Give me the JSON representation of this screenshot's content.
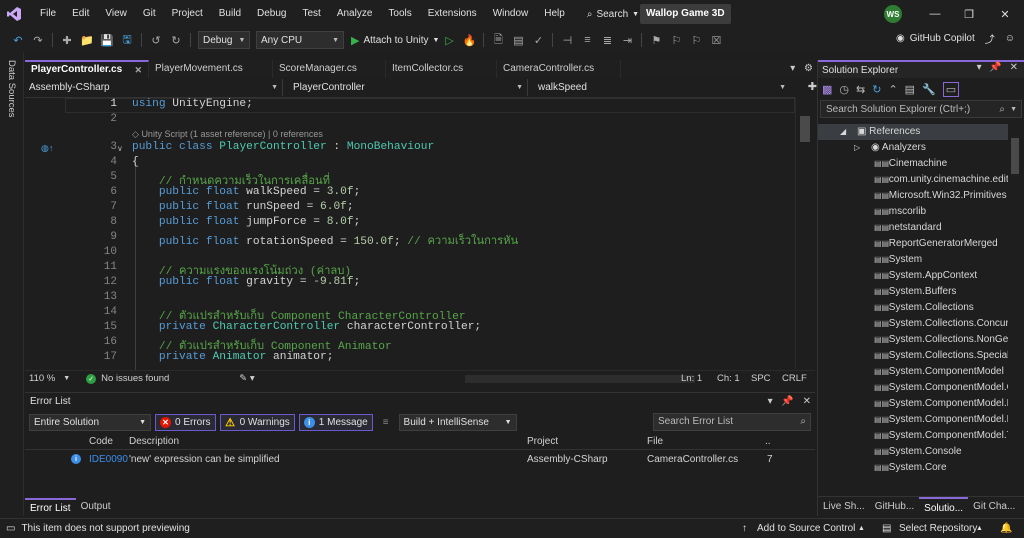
{
  "titlebar": {
    "menu": [
      "File",
      "Edit",
      "View",
      "Git",
      "Project",
      "Build",
      "Debug",
      "Test",
      "Analyze",
      "Tools",
      "Extensions",
      "Window",
      "Help"
    ],
    "search_label": "Search",
    "solution_name": "Wallop Game 3D",
    "avatar_initials": "WS"
  },
  "toolbar": {
    "configuration": "Debug",
    "platform": "Any CPU",
    "attach_label": "Attach to Unity",
    "copilot_label": "GitHub Copilot"
  },
  "left_strip": {
    "label": "Data Sources"
  },
  "tabs": [
    {
      "label": "PlayerController.cs",
      "active": true
    },
    {
      "label": "PlayerMovement.cs",
      "active": false
    },
    {
      "label": "ScoreManager.cs",
      "active": false
    },
    {
      "label": "ItemCollector.cs",
      "active": false
    },
    {
      "label": "CameraController.cs",
      "active": false
    }
  ],
  "navbar": {
    "project": "Assembly-CSharp",
    "type": "PlayerController",
    "member": "walkSpeed"
  },
  "code": {
    "line_numbers": [
      "1",
      "2",
      "3",
      "4",
      "5",
      "6",
      "7",
      "8",
      "9",
      "10",
      "11",
      "12",
      "13",
      "14",
      "15",
      "16",
      "17"
    ],
    "codelens": "Unity Script (1 asset reference) | 0 references",
    "lines": {
      "l1_kw": "using",
      "l1_rest": " UnityEngine;",
      "l3_kw": "public class",
      "l3_name": "PlayerController",
      "l3_colon": " : ",
      "l3_base": "MonoBehaviour",
      "l4": "{",
      "l5_cm": "// กำหนดความเร็วในการเคลื่อนที่",
      "l6_kw": "public float",
      "l6_rest": " walkSpeed = ",
      "l6_num": "3.0f",
      "l7_kw": "public float",
      "l7_rest": " runSpeed = ",
      "l7_num": "6.0f",
      "l8_kw": "public float",
      "l8_rest": " jumpForce = ",
      "l8_num": "8.0f",
      "l9_kw": "public float",
      "l9_rest": " rotationSpeed = ",
      "l9_num": "150.0f",
      "l9_cm": " // ความเร็วในการหัน",
      "l11_cm": "// ความแรงของแรงโน้มถ่วง (ค่าลบ)",
      "l12_kw": "public float",
      "l12_rest": " gravity = ",
      "l12_num": "-9.81f",
      "l14_cm": "// ตัวแปรสำหรับเก็บ Component CharacterController",
      "l15_kw": "private",
      "l15_type": "CharacterController",
      "l15_rest": " characterController;",
      "l16_cm": "// ตัวแปรสำหรับเก็บ Component Animator",
      "l17_kw": "private",
      "l17_type": "Animator",
      "l17_rest": " animator;",
      "semicolon": ";"
    }
  },
  "editor_status": {
    "zoom": "110 %",
    "issues": "No issues found",
    "line": "Ln: 1",
    "col": "Ch: 1",
    "spacing": "SPC",
    "eol": "CRLF"
  },
  "error_list": {
    "title": "Error List",
    "scope": "Entire Solution",
    "errors": "0 Errors",
    "warnings": "0 Warnings",
    "messages": "1 Message",
    "build_filter": "Build + IntelliSense",
    "search_placeholder": "Search Error List",
    "columns": [
      "Code",
      "Description",
      "Project",
      "File",
      ".."
    ],
    "rows": [
      {
        "code": "IDE0090",
        "description": "'new' expression can be simplified",
        "project": "Assembly-CSharp",
        "file": "CameraController.cs",
        "line": "7"
      }
    ],
    "bottom_tabs": [
      "Error List",
      "Output"
    ]
  },
  "solution_explorer": {
    "title": "Solution Explorer",
    "search_placeholder": "Search Solution Explorer (Ctrl+;)",
    "references_label": "References",
    "analyzers_label": "Analyzers",
    "items": [
      "Cinemachine",
      "com.unity.cinemachine.edito",
      "Microsoft.Win32.Primitives",
      "mscorlib",
      "netstandard",
      "ReportGeneratorMerged",
      "System",
      "System.AppContext",
      "System.Buffers",
      "System.Collections",
      "System.Collections.Concurre",
      "System.Collections.NonGene",
      "System.Collections.Speciali",
      "System.ComponentModel",
      "System.ComponentModel.C",
      "System.ComponentModel.E",
      "System.ComponentModel.P",
      "System.ComponentModel.T",
      "System.Console",
      "System.Core"
    ],
    "bottom_tabs": [
      "Live Sh...",
      "GitHub...",
      "Solutio...",
      "Git Cha..."
    ]
  },
  "statusbar": {
    "message": "This item does not support previewing",
    "source_control": "Add to Source Control",
    "repository": "Select Repository"
  },
  "colors": {
    "accent": "#8b68d9",
    "keyword": "#569cd6",
    "type": "#4ec9b0",
    "comment": "#57a64a",
    "number": "#b5cea8"
  }
}
